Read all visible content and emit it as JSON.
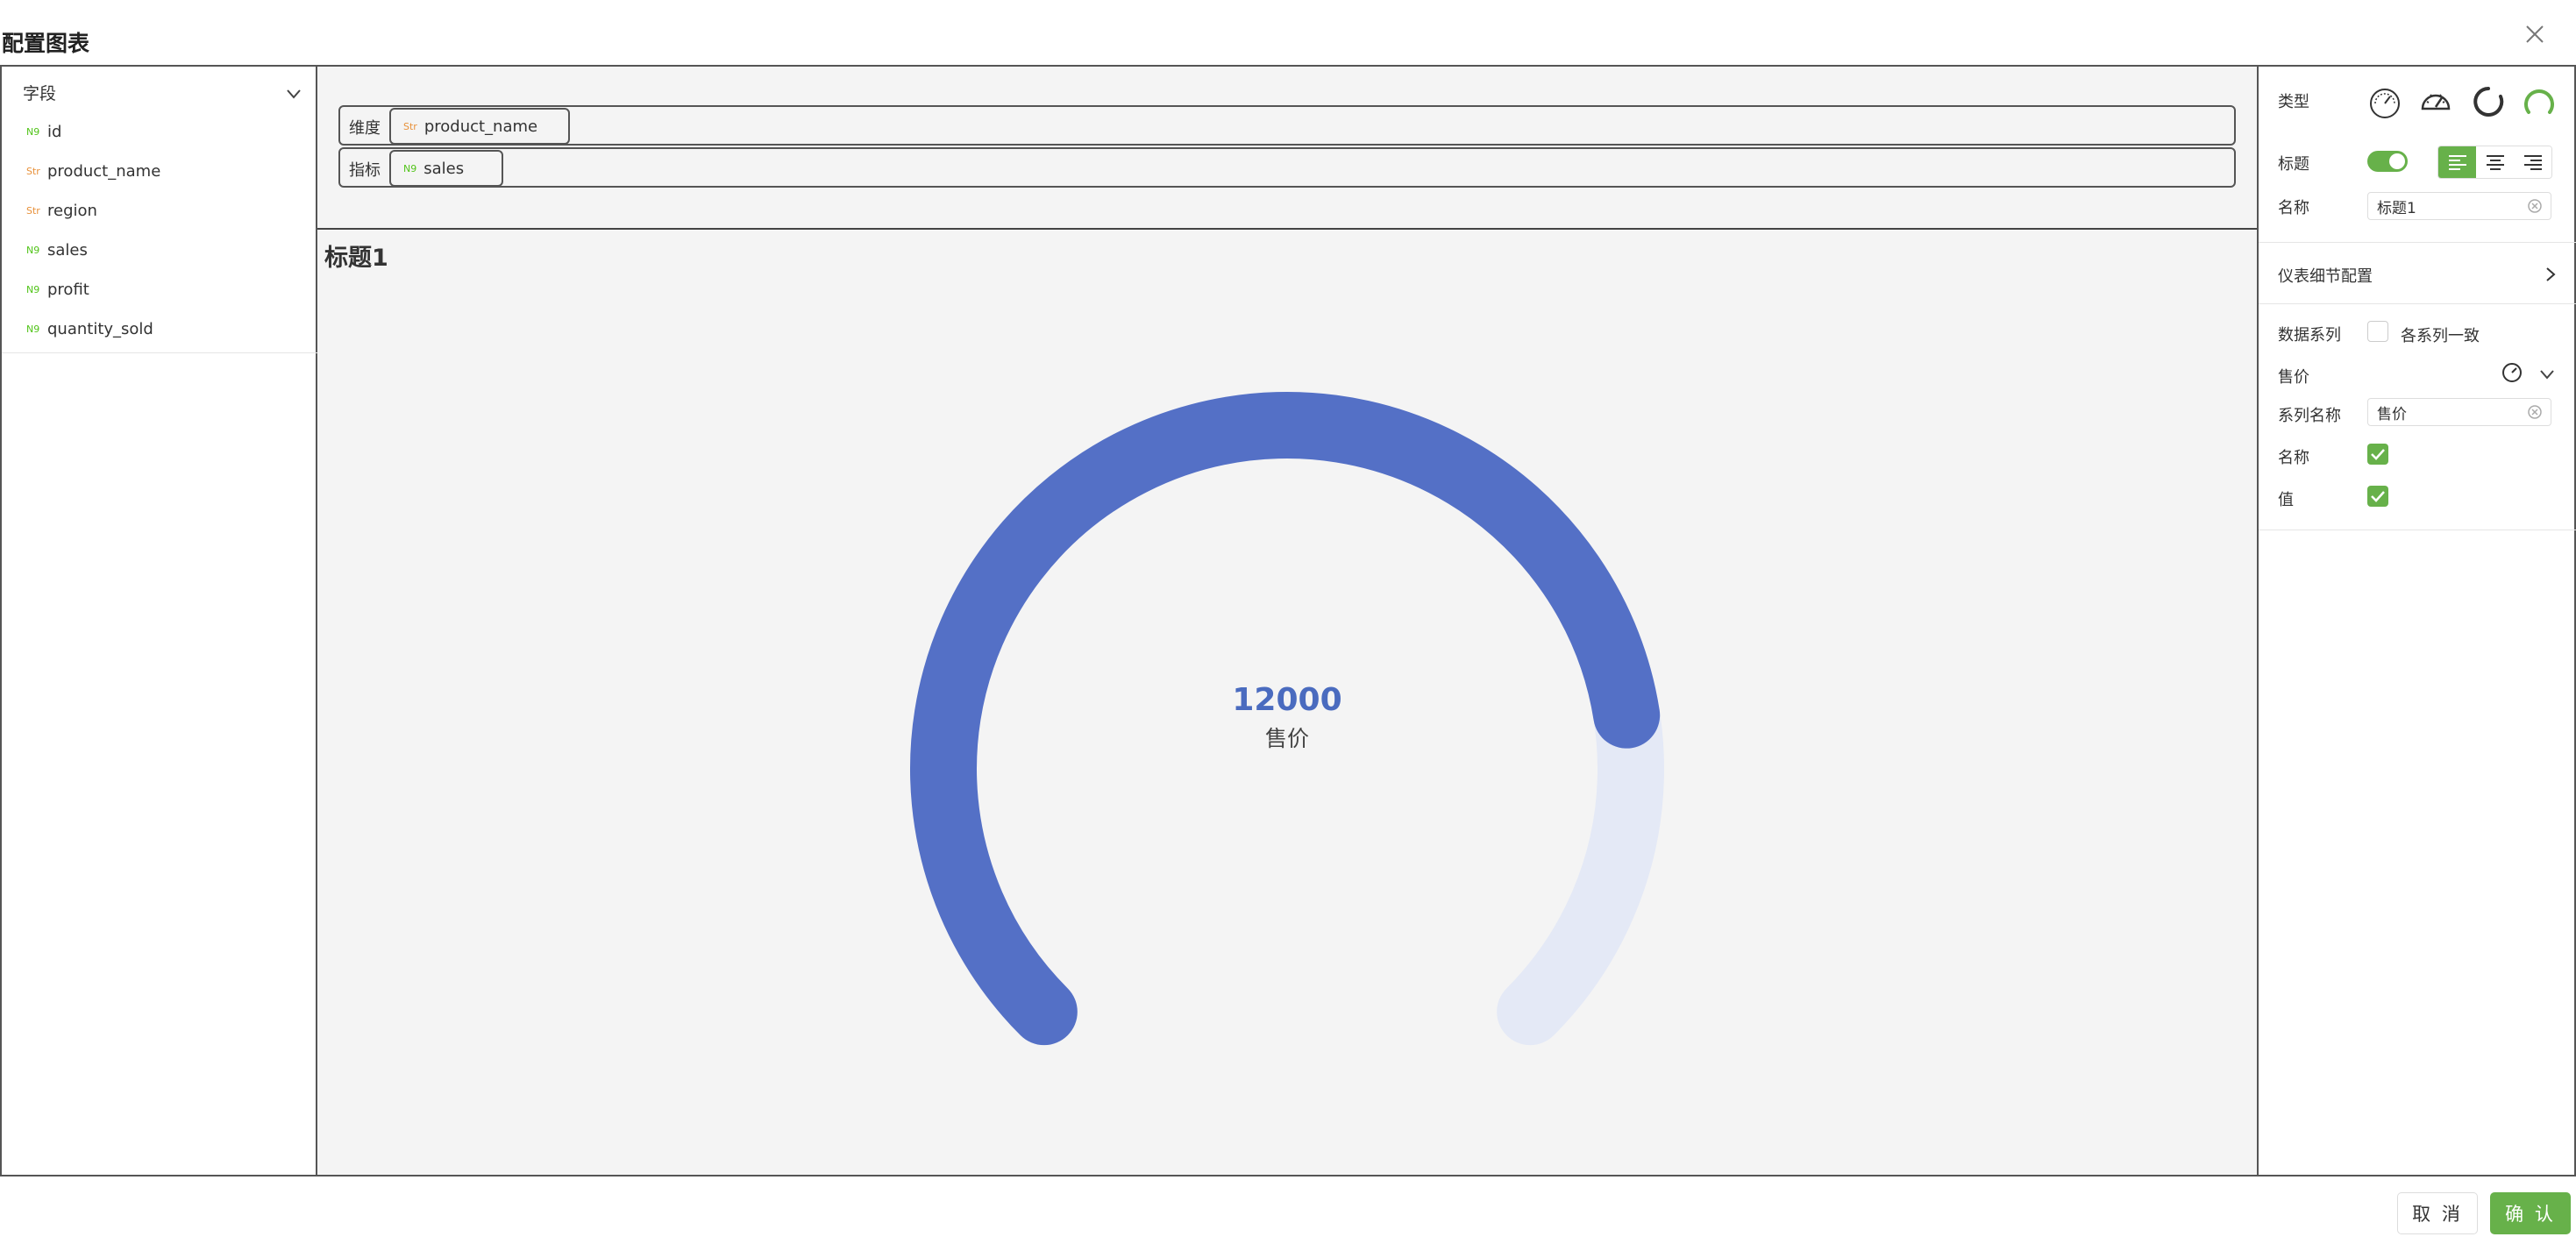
{
  "dialog": {
    "title": "配置图表"
  },
  "fields": {
    "header": "字段",
    "items": [
      {
        "tag": "N9",
        "kind": "num",
        "name": "id"
      },
      {
        "tag": "Str",
        "kind": "str",
        "name": "product_name"
      },
      {
        "tag": "Str",
        "kind": "str",
        "name": "region"
      },
      {
        "tag": "N9",
        "kind": "num",
        "name": "sales"
      },
      {
        "tag": "N9",
        "kind": "num",
        "name": "profit"
      },
      {
        "tag": "N9",
        "kind": "num",
        "name": "quantity_sold"
      }
    ]
  },
  "drops": {
    "dimension": {
      "label": "维度",
      "chip_tag": "Str",
      "chip_name": "product_name"
    },
    "measure": {
      "label": "指标",
      "chip_tag": "N9",
      "chip_name": "sales"
    }
  },
  "chart": {
    "title": "标题1",
    "value_text": "12000",
    "series_label": "售价",
    "progress_fraction": 0.8,
    "colors": {
      "fill": "#5470c6",
      "track": "#e4e9f6",
      "value": "#4a6bbf"
    }
  },
  "settings": {
    "type_label": "类型",
    "title_label": "标题",
    "title_enabled": true,
    "name_label": "名称",
    "name_value": "标题1",
    "gauge_detail": "仪表细节配置",
    "data_series_label": "数据系列",
    "consistent_label": "各系列一致",
    "consistent_checked": false,
    "series_header": "售价",
    "series_name_label": "系列名称",
    "series_name_value": "售价",
    "show_name_label": "名称",
    "show_name_checked": true,
    "show_value_label": "值",
    "show_value_checked": true,
    "accent": "#67b14a"
  },
  "footer": {
    "cancel": "取 消",
    "confirm": "确 认"
  }
}
